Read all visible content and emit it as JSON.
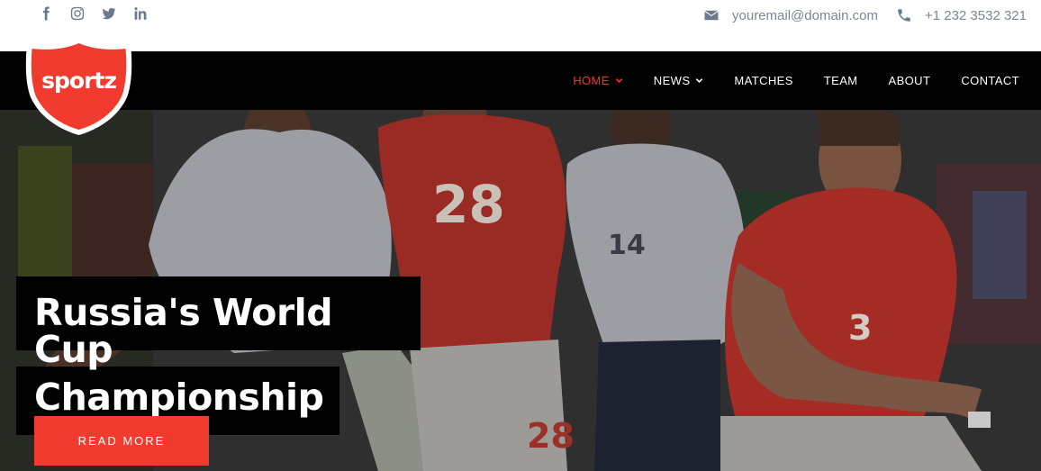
{
  "topbar": {
    "social": [
      {
        "name": "facebook"
      },
      {
        "name": "instagram"
      },
      {
        "name": "twitter"
      },
      {
        "name": "linkedin"
      }
    ],
    "email": "youremail@domain.com",
    "phone": "+1 232 3532 321"
  },
  "brand": {
    "logo_text": "sportz",
    "accent_color": "#f23b2f"
  },
  "nav": {
    "items": [
      {
        "label": "HOME",
        "has_dropdown": true,
        "active": true
      },
      {
        "label": "NEWS",
        "has_dropdown": true,
        "active": false
      },
      {
        "label": "MATCHES",
        "has_dropdown": false,
        "active": false
      },
      {
        "label": "TEAM",
        "has_dropdown": false,
        "active": false
      },
      {
        "label": "ABOUT",
        "has_dropdown": false,
        "active": false
      },
      {
        "label": "CONTACT",
        "has_dropdown": false,
        "active": false
      }
    ]
  },
  "hero": {
    "title_line1": "Russia's World Cup",
    "title_line2": "Championship",
    "cta_label": "READ MORE"
  }
}
